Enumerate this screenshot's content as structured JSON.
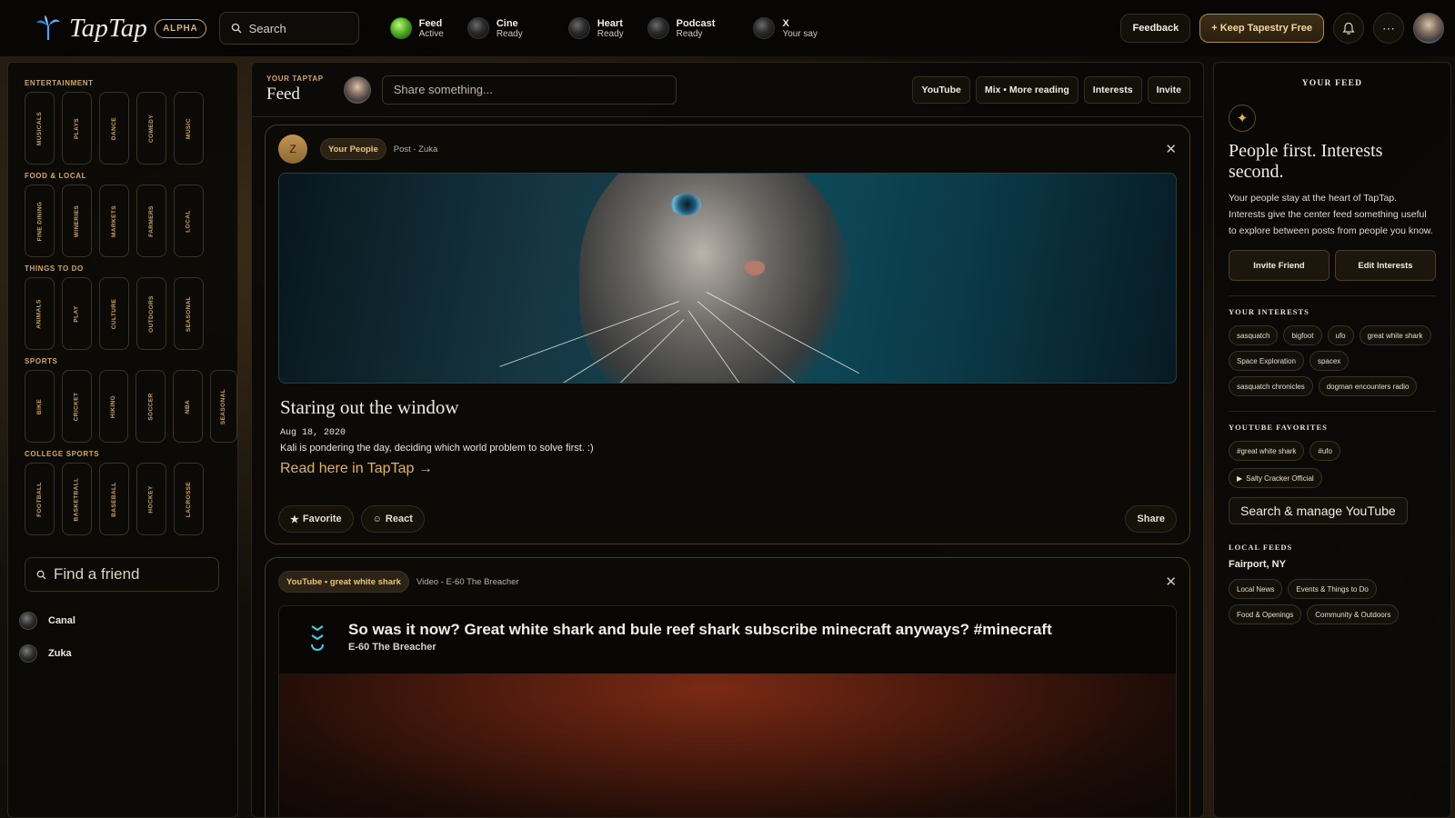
{
  "topbar": {
    "logo_text": "TapTap",
    "alpha_label": "ALPHA",
    "search_placeholder": "Search",
    "channels": [
      {
        "name": "Feed",
        "status": "Active",
        "active": true
      },
      {
        "name": "Cine",
        "status": "Ready",
        "active": false
      },
      {
        "name": "Heart",
        "status": "Ready",
        "active": false
      },
      {
        "name": "Podcast",
        "status": "Ready",
        "active": false
      },
      {
        "name": "X",
        "status": "Your say",
        "active": false
      }
    ],
    "feedback_label": "Feedback",
    "keep_free_label": "+ Keep Tapestry Free"
  },
  "sidebar": {
    "sections": [
      {
        "title": "ENTERTAINMENT",
        "tiles": [
          "MUSICALS",
          "PLAYS",
          "DANCE",
          "COMEDY",
          "MUSIC"
        ]
      },
      {
        "title": "FOOD & LOCAL",
        "tiles": [
          "FINE DINING",
          "WINERIES",
          "MARKETS",
          "FARMERS",
          "LOCAL"
        ]
      },
      {
        "title": "THINGS TO DO",
        "tiles": [
          "ANIMALS",
          "PLAY",
          "CULTURE",
          "OUTDOORS",
          "SEASONAL"
        ]
      },
      {
        "title": "SPORTS",
        "tiles": [
          "BIKE",
          "CRICKET",
          "HIKING",
          "SOCCER",
          "NBA",
          "SEASONAL"
        ]
      },
      {
        "title": "COLLEGE SPORTS",
        "tiles": [
          "FOOTBALL",
          "BASKETBALL",
          "BASEBALL",
          "HOCKEY",
          "LACROSSE"
        ]
      }
    ],
    "find_placeholder": "Find a friend",
    "friends": [
      "Canal",
      "Zuka"
    ]
  },
  "center": {
    "your_taptap": "YOUR TAPTAP",
    "title": "Feed",
    "share_placeholder": "Share something...",
    "buttons": [
      "YouTube",
      "Mix • More reading",
      "Interests",
      "Invite"
    ],
    "post1": {
      "avatar_letter": "Z",
      "tag": "Your People",
      "meta": "Post - Zuka",
      "title": "Staring out the window",
      "date": "Aug 18, 2020",
      "body": "Kali is pondering the day, deciding which world problem to solve first. :)",
      "link": "Read here in TapTap →",
      "favorite": "Favorite",
      "react": "React",
      "share": "Share"
    },
    "post2": {
      "tag": "YouTube • great white shark",
      "meta": "Video - E-60 The Breacher",
      "title": "So was it now? Great white shark and bule reef shark subscribe minecraft anyways? #minecraft",
      "channel": "E-60 The Breacher"
    }
  },
  "right": {
    "panel_title": "YOUR FEED",
    "heading": "People first. Interests second.",
    "description": "Your people stay at the heart of TapTap. Interests give the center feed something useful to explore between posts from people you know.",
    "invite_btn": "Invite Friend",
    "edit_btn": "Edit Interests",
    "interests_title": "YOUR INTERESTS",
    "interests": [
      "sasquatch",
      "bigfoot",
      "ufo",
      "great white shark",
      "Space Exploration",
      "spacex",
      "sasquatch chronicles",
      "dogman encounters radio"
    ],
    "yt_title": "YOUTUBE FAVORITES",
    "yt_tags": [
      "#great white shark",
      "#ufo"
    ],
    "yt_channel": "Salty Cracker Official",
    "yt_manage": "Search & manage YouTube",
    "local_title": "LOCAL FEEDS",
    "city": "Fairport, NY",
    "local_chips": [
      "Local News",
      "Events & Things to Do",
      "Food & Openings",
      "Community & Outdoors"
    ]
  },
  "colors": {
    "accent": "#d6a75c",
    "background": "#0d0b08",
    "active": "#53b52a"
  }
}
